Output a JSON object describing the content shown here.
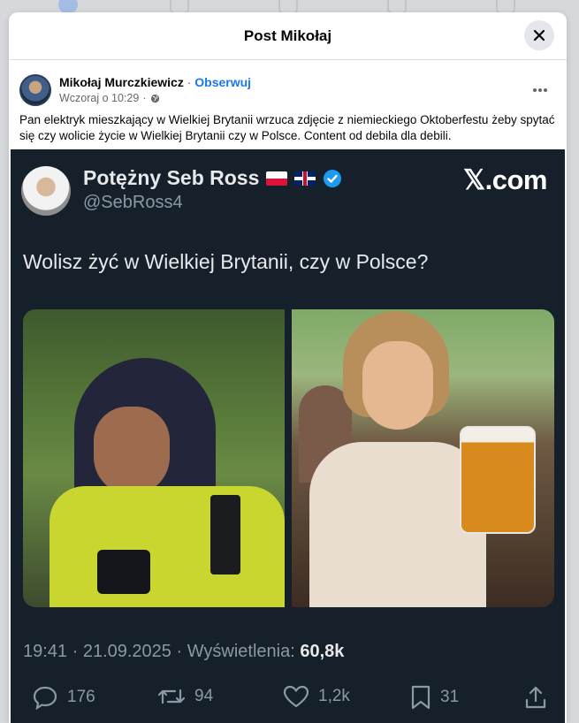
{
  "modal": {
    "title": "Post Mikołaj"
  },
  "post": {
    "author": "Mikołaj Murczkiewicz",
    "separator": " · ",
    "follow_label": "Obserwuj",
    "timestamp": "Wczoraj o 10:29",
    "meta_separator": " · ",
    "caption": "Pan elektryk mieszkający w Wielkiej Brytanii wrzuca zdjęcie z niemieckiego Oktoberfestu żeby spytać się czy wolicie życie w Wielkiej Brytanii czy w Polsce. Content od debila dla debili."
  },
  "tweet": {
    "name": "Potężny Seb Ross",
    "handle": "@SebRoss4",
    "logo": "𝕏.com",
    "text": "Wolisz żyć w Wielkiej Brytanii, czy w Polsce?",
    "meta_prefix": "19:41 · 21.09.2025 · Wyświetlenia: ",
    "views": "60,8k",
    "actions": {
      "replies": "176",
      "reposts": "94",
      "likes": "1,2k",
      "bookmarks": "31"
    }
  },
  "colors": {
    "accent": "#1877f2",
    "tweet_bg": "#15202b",
    "verified": "#1d9bf0"
  }
}
